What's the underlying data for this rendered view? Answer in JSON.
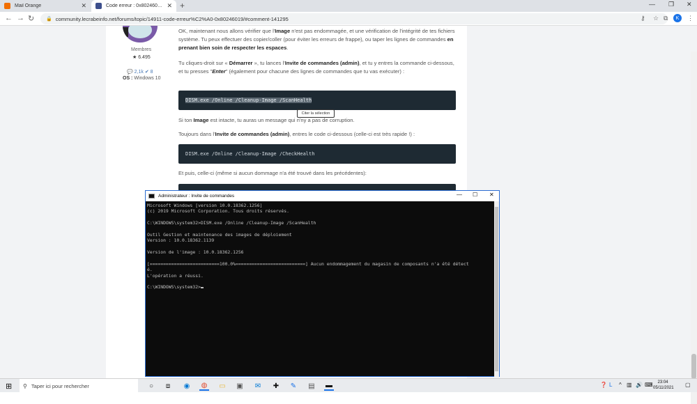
{
  "browser": {
    "tabs": [
      {
        "title": "Mail Orange",
        "color": "#f16e00"
      },
      {
        "title": "Code erreur : 0x80246019 - Windows",
        "color": "#3d4f8c"
      }
    ],
    "new_tab": "+",
    "url": "community.lecrabeinfo.net/forums/topic/14911-code-erreur%C2%A0-0x80246019/#comment-141295",
    "profile": "K"
  },
  "user": {
    "role": "Membres",
    "points": "★ 6.495",
    "stats": "💬 2,1k  ✔ 8",
    "os_label": "OS :",
    "os_value": "Windows 10"
  },
  "post": {
    "p1_a": "OK, maintenant nous allons vérifier que l'",
    "p1_b": "Image",
    "p1_c": " n'est pas endommagée, et une vérification de l'intégrité de tes fichiers système. Tu peux effectuer des copier/coller (pour éviter les erreurs de frappe), ou taper les lignes de commandes ",
    "p1_d": "en prenant bien soin de respecter les espaces",
    "p1_e": ".",
    "p2_a": "Tu cliques-droit sur « ",
    "p2_b": "Démarrer",
    "p2_c": " », tu lances l'",
    "p2_d": "Invite de commandes (admin)",
    "p2_e": ", et tu y entres la commande ci-dessous, et tu presses \"",
    "p2_f": "Enter",
    "p2_g": "\" (également pour chacune des lignes de commandes que tu vas exécuter) :",
    "code1": "DISM.exe /Online /Cleanup-Image /ScanHealth",
    "tooltip": "Citer la sélection",
    "p3_a": "Si ton ",
    "p3_b": "Image",
    "p3_c": " est intacte, tu auras un message qui n'ny a pas de corruption.",
    "p4_a": "Toujours dans l'",
    "p4_b": "Invite de commandes (admin)",
    "p4_c": ", entres le code ci-dessous (celle-ci est très rapide !) :",
    "code2": "DISM.exe /Online /Cleanup-Image /CheckHealth",
    "p5": "Et puis, celle-ci (même si aucun dommage n'a été trouvé dans les précédentes):"
  },
  "cmd": {
    "title": "Administrateur : Invite de commandes",
    "lines": [
      "Microsoft Windows [version 10.0.18362.1256]",
      "(c) 2019 Microsoft Corporation. Tous droits réservés.",
      "",
      "C:\\WINDOWS\\system32>DISM.exe /Online /Cleanup-Image /ScanHealth",
      "",
      "Outil Gestion et maintenance des images de déploiement",
      "Version : 10.0.18362.1139",
      "",
      "Version de l'image : 10.0.18362.1256",
      "",
      "[==========================100.0%==========================] Aucun endommagement du magasin de composants n'a été détect",
      "é.",
      "L'opération a réussi.",
      "",
      "C:\\WINDOWS\\system32>"
    ]
  },
  "taskbar": {
    "search_placeholder": "Taper ici pour rechercher",
    "time": "23:04",
    "date": "05/11/2021"
  }
}
